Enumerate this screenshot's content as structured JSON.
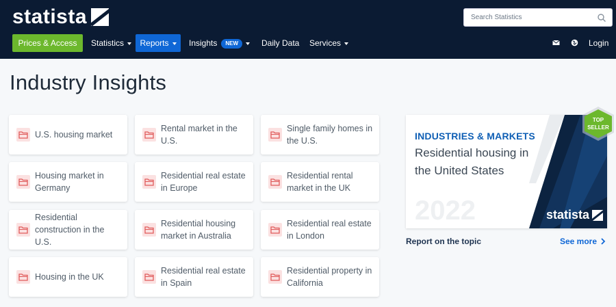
{
  "brand": {
    "logo_text": "statista"
  },
  "search": {
    "placeholder": "Search Statistics"
  },
  "nav": {
    "prices_access": "Prices & Access",
    "statistics": "Statistics",
    "reports": "Reports",
    "insights": "Insights",
    "insights_badge": "NEW",
    "daily_data": "Daily Data",
    "services": "Services",
    "login": "Login"
  },
  "colors": {
    "header_bg": "#0b1b33",
    "accent_green": "#6cb82d",
    "accent_blue": "#0f67d6",
    "folder_red": "#e05a5a"
  },
  "page": {
    "title": "Industry Insights"
  },
  "cards": [
    "U.S. housing market",
    "Rental market in the U.S.",
    "Single family homes in the U.S.",
    "Housing market in Germany",
    "Residential real estate in Europe",
    "Residential rental market in the UK",
    "Residential construction in the U.S.",
    "Residential housing market in Australia",
    "Residential real estate in London",
    "Housing in the UK",
    "Residential real estate in Spain",
    "Residential property in California"
  ],
  "promo": {
    "kicker": "INDUSTRIES & MARKETS",
    "title": "Residential housing in the United States",
    "year": "2022",
    "logo_text": "statista",
    "badge_line1": "TOP",
    "badge_line2": "SELLER"
  },
  "footer_links": {
    "report": "Report on the topic",
    "see_more": "See more"
  }
}
